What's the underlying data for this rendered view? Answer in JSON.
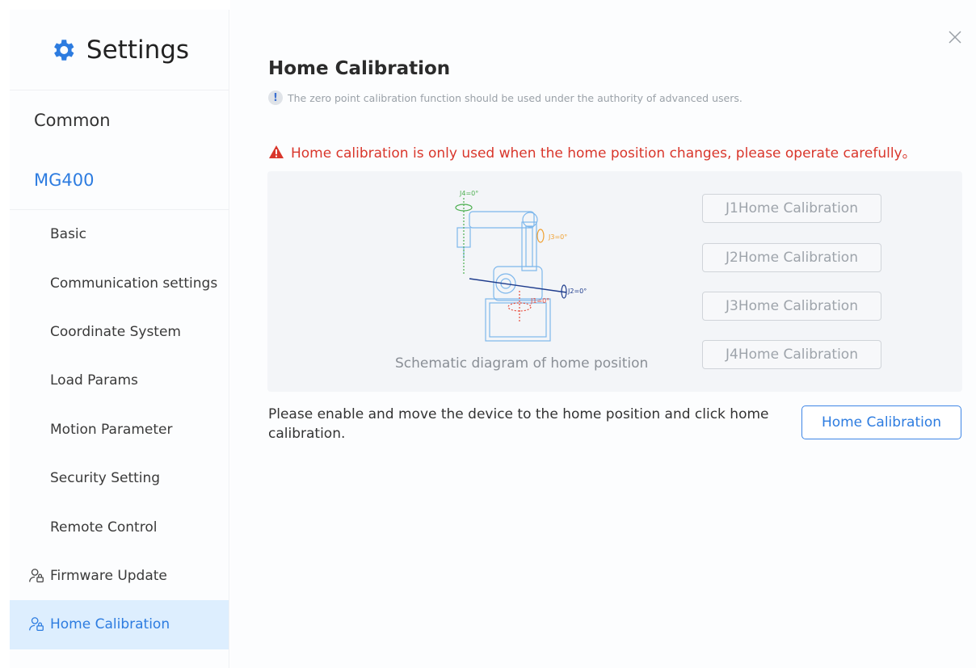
{
  "sidebar": {
    "title": "Settings",
    "sections": [
      {
        "label": "Common"
      },
      {
        "label": "MG400"
      }
    ],
    "items": [
      {
        "label": "Basic"
      },
      {
        "label": "Communication settings"
      },
      {
        "label": "Coordinate System"
      },
      {
        "label": "Load Params"
      },
      {
        "label": "Motion Parameter"
      },
      {
        "label": "Security Setting"
      },
      {
        "label": "Remote Control"
      },
      {
        "label": "Firmware Update"
      },
      {
        "label": "Home Calibration"
      }
    ],
    "selected_item": "Home Calibration"
  },
  "main": {
    "title": "Home Calibration",
    "note": "The zero point calibration function should be used under the authority of advanced users.",
    "warning": "Home calibration is only used when the home position changes, please operate carefully。",
    "diagram": {
      "caption": "Schematic diagram of home position",
      "labels": {
        "j1": "J1=0°",
        "j2": "J2=0°",
        "j3": "J3=0°",
        "j4": "J4=0°"
      }
    },
    "joint_buttons": [
      {
        "label": "J1Home Calibration"
      },
      {
        "label": "J2Home Calibration"
      },
      {
        "label": "J3Home Calibration"
      },
      {
        "label": "J4Home Calibration"
      }
    ],
    "instruction": "Please enable and move the device to the home position and click home calibration.",
    "primary_button": "Home Calibration"
  },
  "colors": {
    "accent": "#2d7ce0",
    "warning": "#d9362b",
    "selected_bg": "#ddeefe"
  }
}
